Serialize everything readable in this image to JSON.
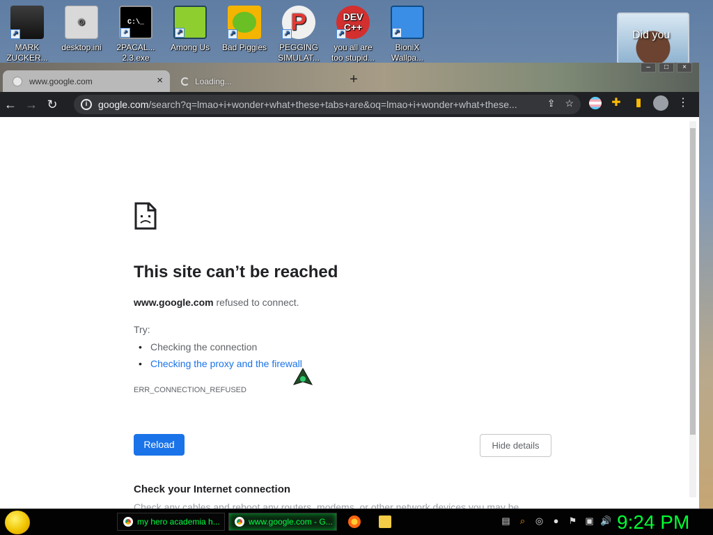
{
  "desktop": {
    "icons": [
      {
        "label_1": "MARK",
        "label_2": "ZUCKER..."
      },
      {
        "label_1": "desktop.ini",
        "label_2": ""
      },
      {
        "label_1": "2PACAL...",
        "label_2": "2.3.exe"
      },
      {
        "label_1": "Among Us",
        "label_2": ""
      },
      {
        "label_1": "Bad Piggies",
        "label_2": ""
      },
      {
        "label_1": "PEGGING",
        "label_2": "SIMULAT..."
      },
      {
        "label_1": "you all are",
        "label_2": "too stupid..."
      },
      {
        "label_1": "BioniX",
        "label_2": "Wallpa..."
      }
    ],
    "widget_caption": "Did you"
  },
  "browser": {
    "tabs": [
      {
        "title": "www.google.com"
      },
      {
        "title": "Loading..."
      }
    ],
    "url_host": "google.com",
    "url_path": "/search?q=lmao+i+wonder+what+these+tabs+are&oq=lmao+i+wonder+what+these..."
  },
  "error_page": {
    "heading": "This site can’t be reached",
    "host": "www.google.com",
    "refused_text": " refused to connect.",
    "try_label": "Try:",
    "suggestions": [
      "Checking the connection",
      "Checking the proxy and the firewall"
    ],
    "error_code": "ERR_CONNECTION_REFUSED",
    "reload_label": "Reload",
    "hide_details_label": "Hide details",
    "details_heading": "Check your Internet connection",
    "details_text": "Check any cables and reboot any routers, modems, or other network devices you may be"
  },
  "taskbar": {
    "tasks": [
      "my hero academia h...",
      "www.google.com - G..."
    ],
    "clock": "9:24 PM"
  }
}
